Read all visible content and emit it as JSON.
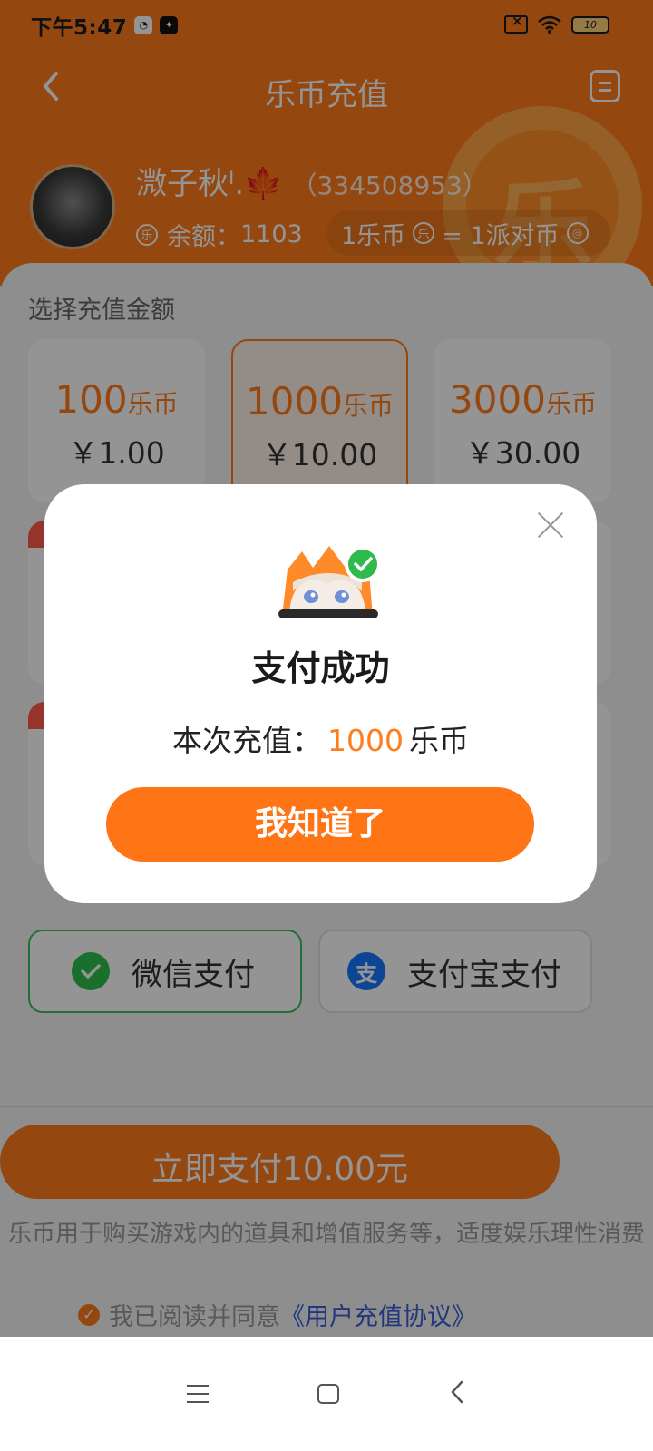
{
  "status_bar": {
    "time": "下午5:47",
    "battery": "10"
  },
  "header": {
    "title": "乐币充值",
    "coin_watermark": "乐"
  },
  "user": {
    "name": "溦子秋ᴵ.🍁",
    "id": "（334508953）",
    "balance_label": "余额：",
    "balance_value": "1103",
    "rate_left": "1乐币",
    "rate_right": "= 1派对币"
  },
  "recharge": {
    "section_label": "选择充值金额",
    "options": [
      {
        "amount": "100",
        "unit": "乐币",
        "price": "￥1.00",
        "selected": false
      },
      {
        "amount": "1000",
        "unit": "乐币",
        "price": "￥10.00",
        "selected": true
      },
      {
        "amount": "3000",
        "unit": "乐币",
        "price": "￥30.00",
        "selected": false
      }
    ]
  },
  "payment": {
    "wechat_label": "微信支付",
    "alipay_label": "支付宝支付",
    "alipay_icon_glyph": "支",
    "pay_now_label": "立即支付10.00元",
    "notice": "乐币用于购买游戏内的道具和增值服务等，适度娱乐理性消费",
    "agree_prefix": "我已阅读并同意",
    "agree_link": "《用户充值协议》"
  },
  "modal": {
    "title": "支付成功",
    "text_prefix": "本次充值：",
    "amount": "1000",
    "text_suffix": "乐币",
    "ok_label": "我知道了"
  },
  "colors": {
    "brand_orange": "#ff7d1c",
    "wechat_green": "#2ec04c",
    "alipay_blue": "#1677ff",
    "link_blue": "#3a5fd9"
  },
  "icons": {
    "back": "chevron-left-icon",
    "menu": "document-list-icon",
    "close": "close-icon",
    "success": "check-circle-icon"
  }
}
